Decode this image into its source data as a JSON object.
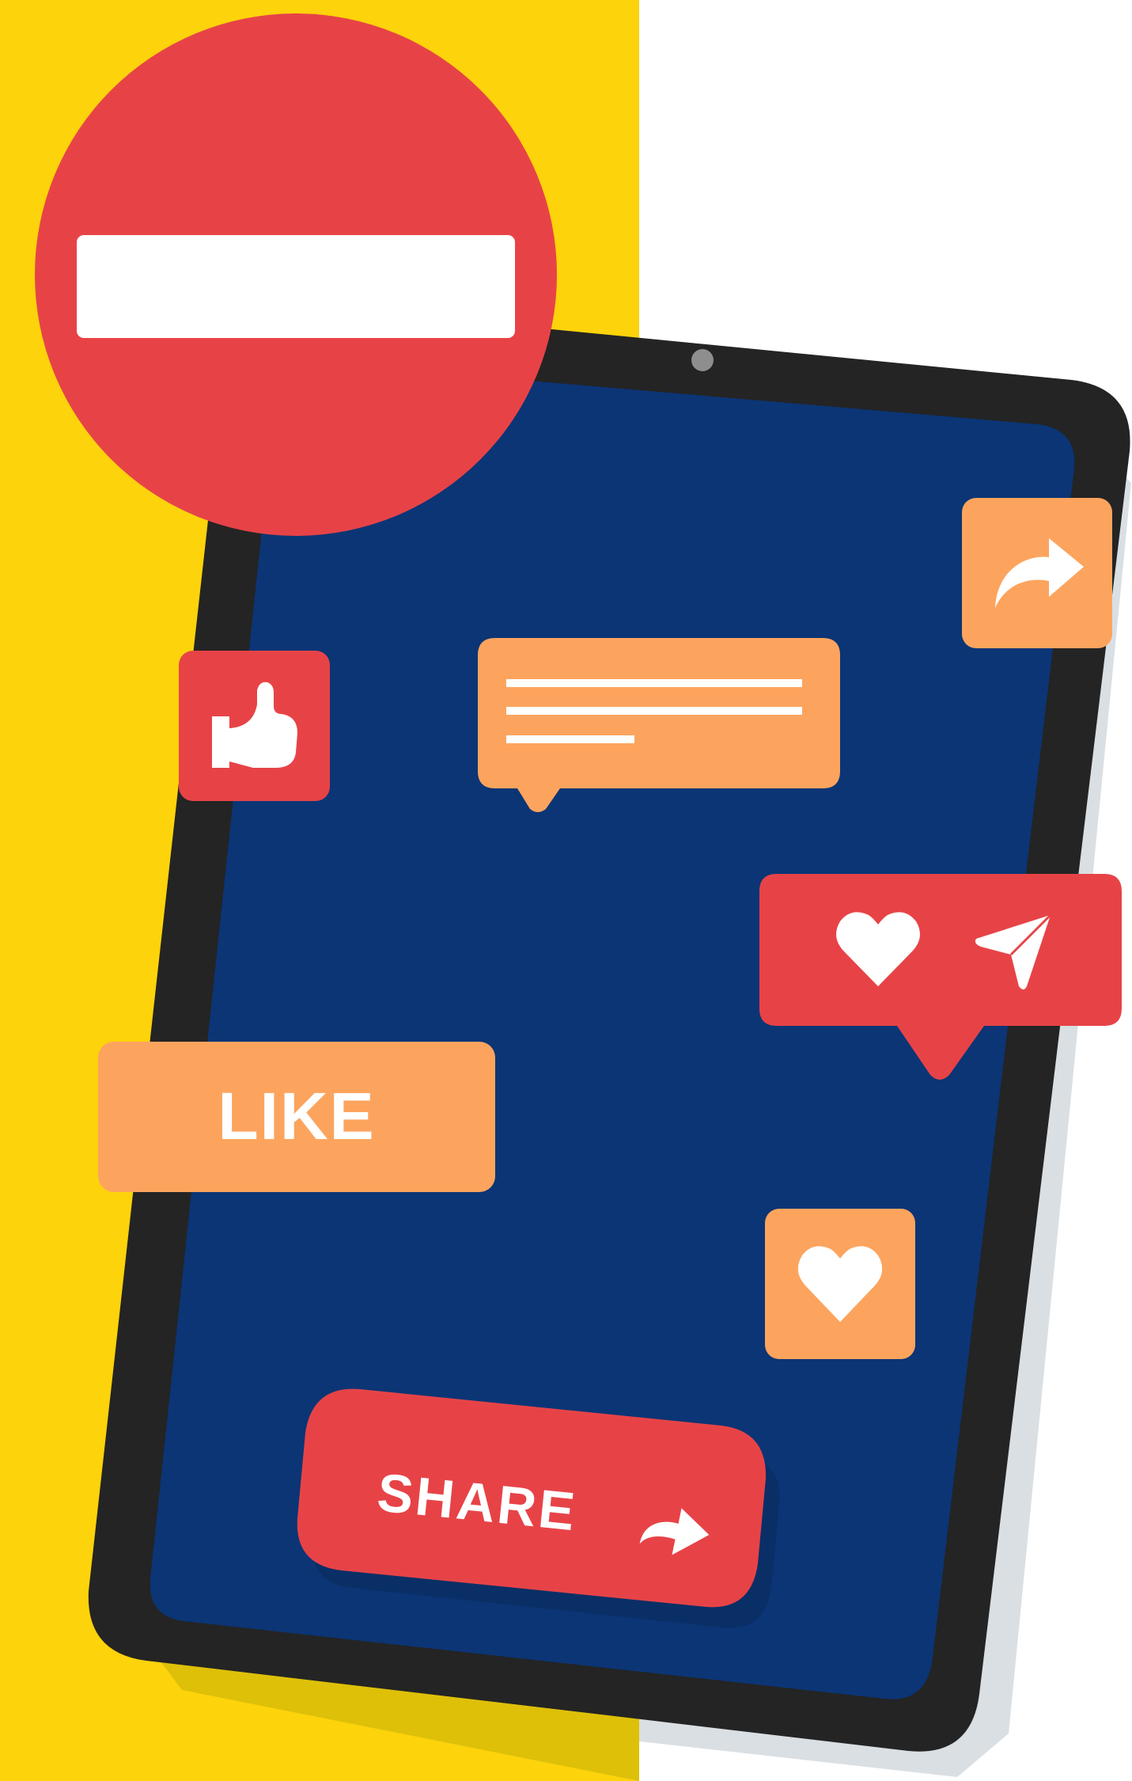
{
  "colors": {
    "background_left": "#FDD30B",
    "background_right": "#FFFFFF",
    "device_frame": "#242424",
    "screen": "#0B3575",
    "red": "#E74347",
    "orange": "#FCA45E",
    "white": "#FFFFFF"
  },
  "labels": {
    "like": "LIKE",
    "share": "SHARE"
  },
  "icons": {
    "blocked": "no-entry-icon",
    "like": "thumbs-up-icon",
    "share": "share-arrow-icon",
    "heart": "heart-icon",
    "send": "paper-plane-icon",
    "comment": "comment-bubble-icon"
  }
}
